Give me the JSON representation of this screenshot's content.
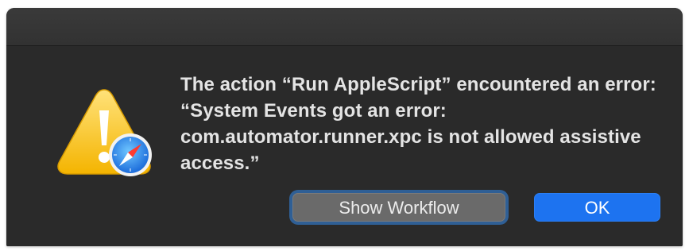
{
  "dialog": {
    "message": "The action “Run AppleScript” encountered an error: “System Events got an error: com.automator.runner.xpc is not allowed assistive access.”",
    "icon": "warning-triangle-with-safari-badge-icon"
  },
  "buttons": {
    "secondary_label": "Show Workflow",
    "primary_label": "OK"
  },
  "colors": {
    "background": "#2a2a2a",
    "text": "#e4e4e4",
    "primary_button": "#1d73f0",
    "secondary_button": "#6a6a6a",
    "focus_ring": "#2f5f95"
  }
}
